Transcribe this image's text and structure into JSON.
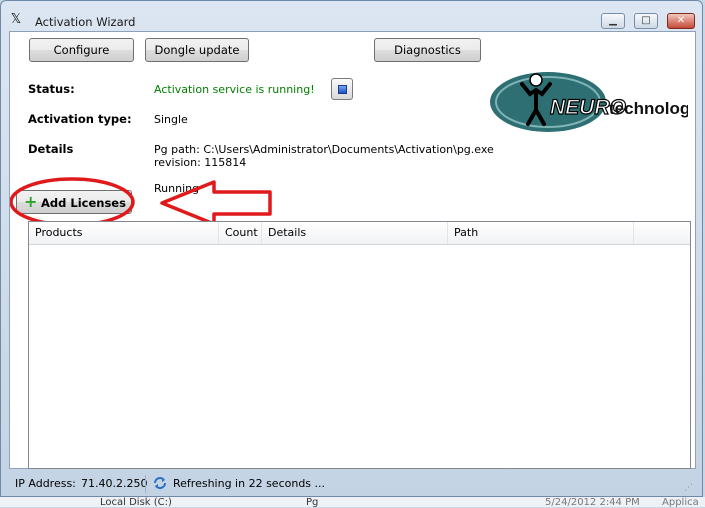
{
  "window": {
    "title": "Activation Wizard",
    "controls": {
      "minimize": "▁",
      "maximize": "□",
      "close": "✕"
    }
  },
  "toolbar": {
    "configure_label": "Configure",
    "dongle_update_label": "Dongle update",
    "diagnostics_label": "Diagnostics"
  },
  "logo": {
    "neuro": "NEURO",
    "technology": "technology"
  },
  "info": {
    "status_label": "Status:",
    "status_value": "Activation service is running!",
    "activation_type_label": "Activation type:",
    "activation_type_value": "Single",
    "details_label": "Details",
    "details_line1": "Pg path: C:\\Users\\Administrator\\Documents\\Activation\\pg.exe",
    "details_line2": "revision: 115814",
    "details_line3": "Running"
  },
  "add_licenses": {
    "label": "Add Licenses"
  },
  "table": {
    "columns": [
      "Products",
      "Count",
      "Details",
      "Path"
    ],
    "rows": []
  },
  "statusbar": {
    "ip_label": "IP Address:",
    "ip_value": "71.40.2.250",
    "refresh_text": "Refreshing in 22 seconds ..."
  },
  "background": {
    "item1": "Local Disk (C:)",
    "item2": "Pg",
    "item3": "5/24/2012 2:44 PM",
    "item4": "Applica"
  },
  "colors": {
    "status_green": "#008000",
    "annotation_red": "#e0191b",
    "plus_green": "#2fa32a"
  }
}
